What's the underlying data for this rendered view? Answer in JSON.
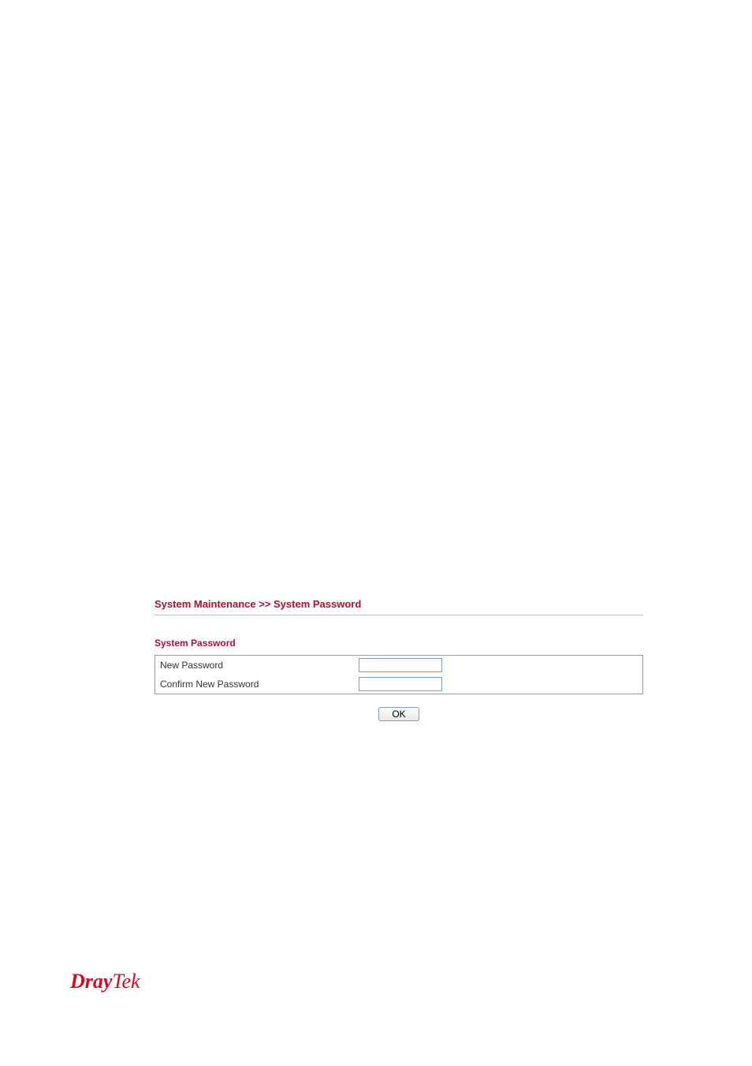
{
  "breadcrumb": "System Maintenance >> System Password",
  "section_title": "System Password",
  "form": {
    "new_password_label": "New Password",
    "confirm_new_password_label": "Confirm New Password",
    "new_password_value": "",
    "confirm_new_password_value": ""
  },
  "buttons": {
    "ok": "OK"
  },
  "footer": {
    "brand_bold": "Dray",
    "brand_light": "Tek"
  }
}
